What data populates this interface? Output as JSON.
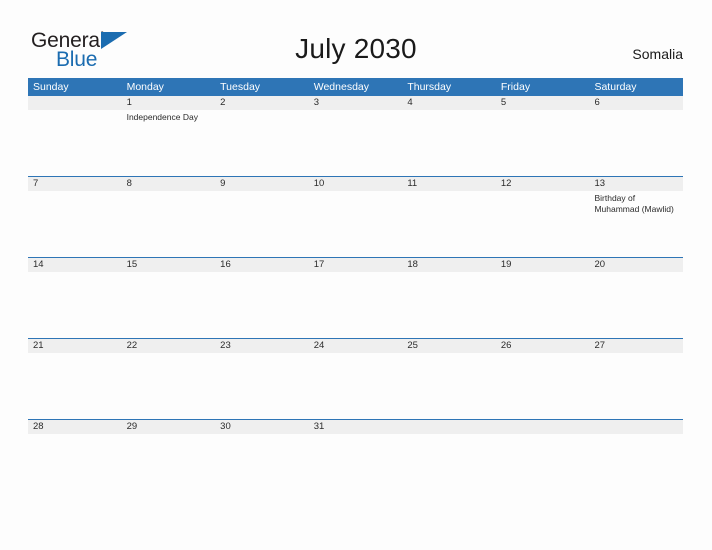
{
  "brand": {
    "line1": "General",
    "line2": "Blue",
    "triangle_icon": "blue-triangle-icon",
    "accent_color": "#1b6cb0"
  },
  "header": {
    "title": "July 2030",
    "country": "Somalia"
  },
  "colors": {
    "header_blue": "#2e75b6",
    "row_divider_blue": "#2e75b6",
    "date_band_gray": "#efefef",
    "page_background": "#fdfdfd",
    "text": "#2b2b2b"
  },
  "calendar": {
    "weekdays": [
      "Sunday",
      "Monday",
      "Tuesday",
      "Wednesday",
      "Thursday",
      "Friday",
      "Saturday"
    ],
    "weeks": [
      {
        "dates": [
          "",
          "1",
          "2",
          "3",
          "4",
          "5",
          "6"
        ],
        "events": [
          [],
          [
            "Independence Day"
          ],
          [],
          [],
          [],
          [],
          []
        ]
      },
      {
        "dates": [
          "7",
          "8",
          "9",
          "10",
          "11",
          "12",
          "13"
        ],
        "events": [
          [],
          [],
          [],
          [],
          [],
          [],
          [
            "Birthday of Muhammad (Mawlid)"
          ]
        ]
      },
      {
        "dates": [
          "14",
          "15",
          "16",
          "17",
          "18",
          "19",
          "20"
        ],
        "events": [
          [],
          [],
          [],
          [],
          [],
          [],
          []
        ]
      },
      {
        "dates": [
          "21",
          "22",
          "23",
          "24",
          "25",
          "26",
          "27"
        ],
        "events": [
          [],
          [],
          [],
          [],
          [],
          [],
          []
        ]
      },
      {
        "dates": [
          "28",
          "29",
          "30",
          "31",
          "",
          "",
          ""
        ],
        "events": [
          [],
          [],
          [],
          [],
          [],
          [],
          []
        ]
      }
    ]
  }
}
